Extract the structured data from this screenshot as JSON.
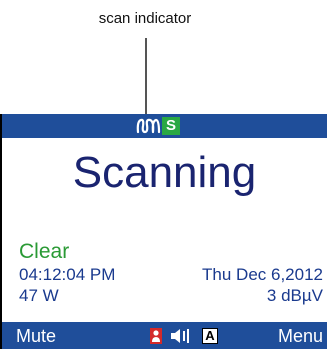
{
  "callout": {
    "label": "scan indicator"
  },
  "top_bar": {
    "indicators": [
      {
        "name": "scan-indicator-icon",
        "color": "#ffffff"
      },
      {
        "name": "s-badge",
        "text": "S",
        "color": "#2aa844"
      }
    ]
  },
  "display": {
    "status": "Scanning",
    "channel_state": "Clear",
    "time": "04:12:04 PM",
    "date": "Thu Dec 6,2012",
    "power": "47 W",
    "signal": "3 dBµV"
  },
  "bottom_bar": {
    "left_softkey": "Mute",
    "right_softkey": "Menu",
    "icons": [
      "person-icon",
      "speaker-icon",
      "a-badge"
    ],
    "a_badge_text": "A"
  },
  "colors": {
    "bar_blue": "#1f4e9a",
    "title_navy": "#1a2470",
    "clear_green": "#2a9a35",
    "info_blue": "#1a3a8e",
    "person_red": "#d42a2a"
  }
}
